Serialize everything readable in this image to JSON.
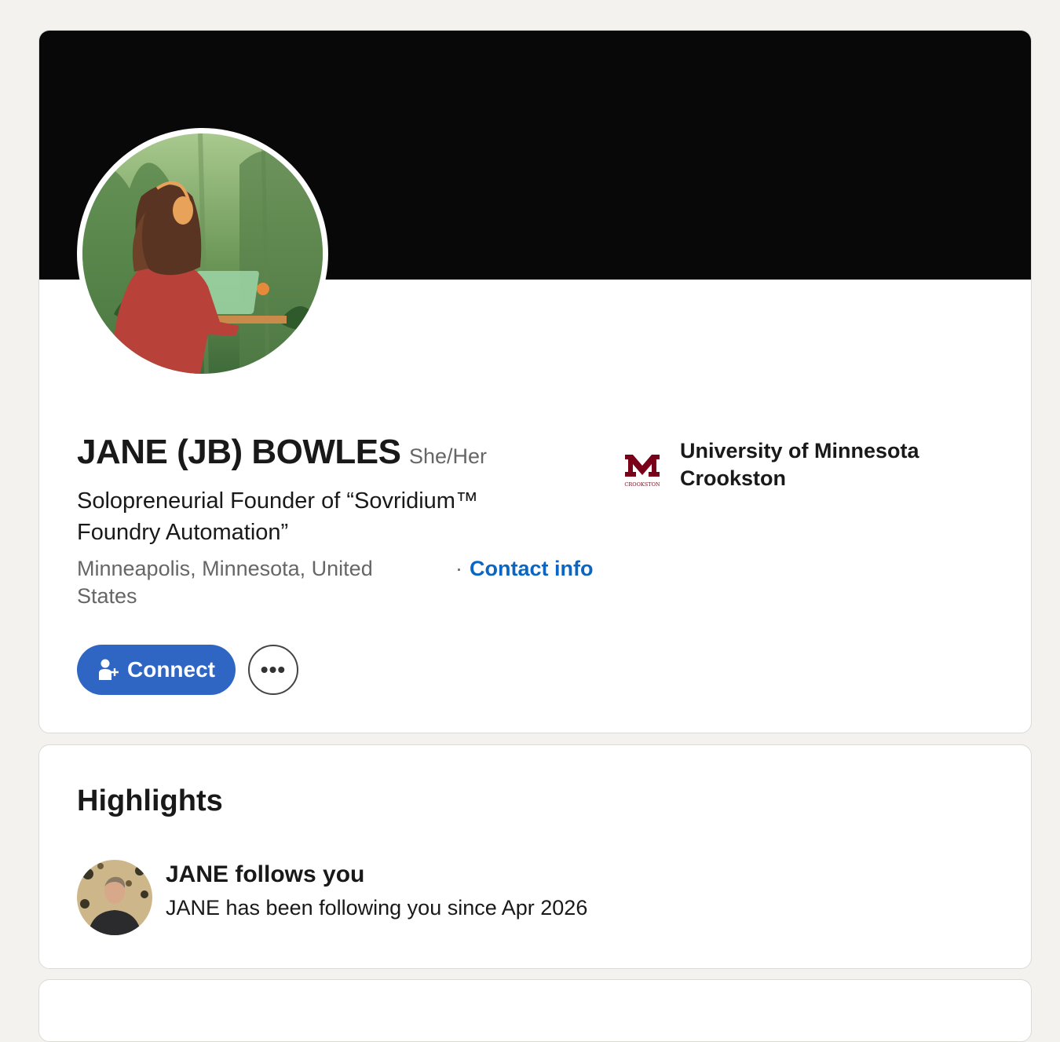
{
  "profile": {
    "name": "JANE (JB) BOWLES",
    "pronouns": "She/Her",
    "headline": "Solopreneurial Founder of “Sovridium™ Foundry Automation”",
    "location": "Minneapolis, Minnesota, United States",
    "separator": "·",
    "contact_info_label": "Contact info",
    "education": {
      "school": "University of Minnesota Crookston",
      "logo_text": "CROOKSTON",
      "logo_color": "#7a0019"
    },
    "actions": {
      "connect_label": "Connect",
      "more_label": "•••"
    },
    "colors": {
      "banner": "#080808",
      "accent": "#2f66c4",
      "link": "#0a66c2"
    }
  },
  "highlights": {
    "title": "Highlights",
    "items": [
      {
        "headline": "JANE follows you",
        "detail": "JANE has been following you since Apr 2026"
      }
    ]
  }
}
